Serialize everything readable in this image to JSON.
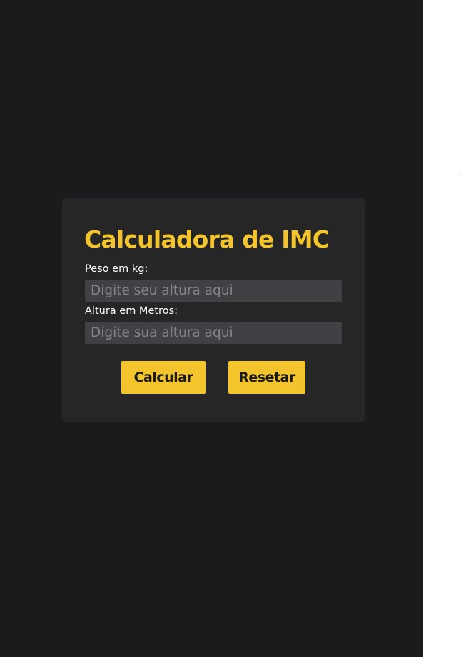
{
  "form": {
    "title": "Calculadora de IMC",
    "peso_label": "Peso em kg:",
    "peso_placeholder": "Digite seu altura aqui",
    "peso_value": "",
    "altura_label": "Altura em Metros:",
    "altura_placeholder": "Digite sua altura aqui",
    "altura_value": ""
  },
  "buttons": {
    "calcular_label": "Calcular",
    "resetar_label": "Resetar"
  },
  "colors": {
    "page_background": "#1b1b1d",
    "card_background": "#262626",
    "accent": "#f3c42b",
    "input_background": "#404045",
    "placeholder_text": "#83838b",
    "button_text": "#1b1b1d"
  }
}
